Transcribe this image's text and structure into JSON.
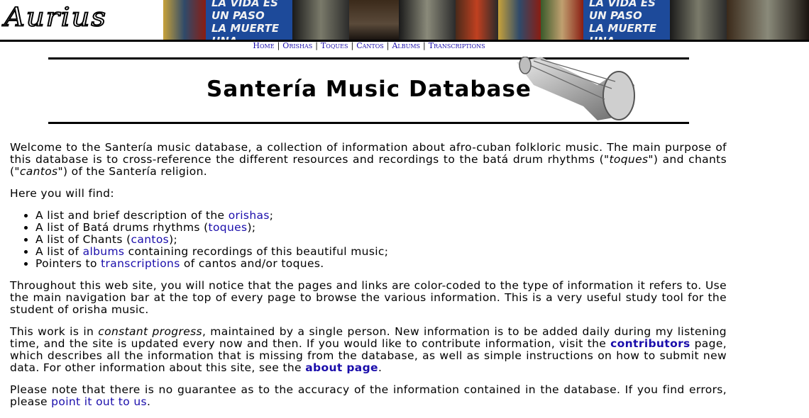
{
  "banner": {
    "logo_text": "Aurius",
    "poster_lines": [
      "LA VIDA ES UN PASO",
      "LA MUERTE",
      "UNA CARRERA"
    ]
  },
  "nav": {
    "items": [
      {
        "label": "Home"
      },
      {
        "label": "Orishas"
      },
      {
        "label": "Toques"
      },
      {
        "label": "Cantos"
      },
      {
        "label": "Albums"
      },
      {
        "label": "Transcriptions"
      }
    ]
  },
  "page_title": "Santería Music Database",
  "intro": {
    "p1_a": "Welcome to the Santería music database, a collection of information about afro-cuban folkloric music. The main purpose of this database is to cross-reference the different resources and recordings to the batá drum rhythms (",
    "p1_toques": "\"toques\"",
    "p1_b": ") and chants (",
    "p1_cantos": "\"cantos\"",
    "p1_c": ") of the Santería religion.",
    "find": "Here you will find:"
  },
  "list": {
    "i1_a": "A list and brief description of the ",
    "i1_link": "orishas",
    "i1_b": ";",
    "i2_a": "A list of Batá drums rhythms (",
    "i2_link": "toques",
    "i2_b": ");",
    "i3_a": "A list of Chants (",
    "i3_link": "cantos",
    "i3_b": ");",
    "i4_a": "A list of ",
    "i4_link": "albums",
    "i4_b": " containing recordings of this beautiful music;",
    "i5_a": "Pointers to ",
    "i5_link": "transcriptions",
    "i5_b": " of cantos and/or toques."
  },
  "p_throughout": "Throughout this web site, you will notice that the pages and links are color-coded to the type of information it refers to. Use the main navigation bar at the top of every page to browse the various information. This is a very useful study tool for the student of orisha music.",
  "work": {
    "a": "This work is in ",
    "em": "constant progress",
    "b": ", maintained by a single person. New information is to be added daily during my listening time, and the site is updated every now and then. If you would like to contribute information, visit the ",
    "contrib_link": "contributors",
    "c": " page, which describes all the information that is missing from the database, as well as simple instructions on how to submit new data. For other information about this site, see the ",
    "about_link": "about page",
    "d": "."
  },
  "note": {
    "a": "Please note that there is no guarantee as to the accuracy of the information contained in the database. If you find errors, please ",
    "link": "point it out to us",
    "b": "."
  },
  "colors": {
    "link": "#1a0dab",
    "banner_bg": "#2a1a12"
  }
}
